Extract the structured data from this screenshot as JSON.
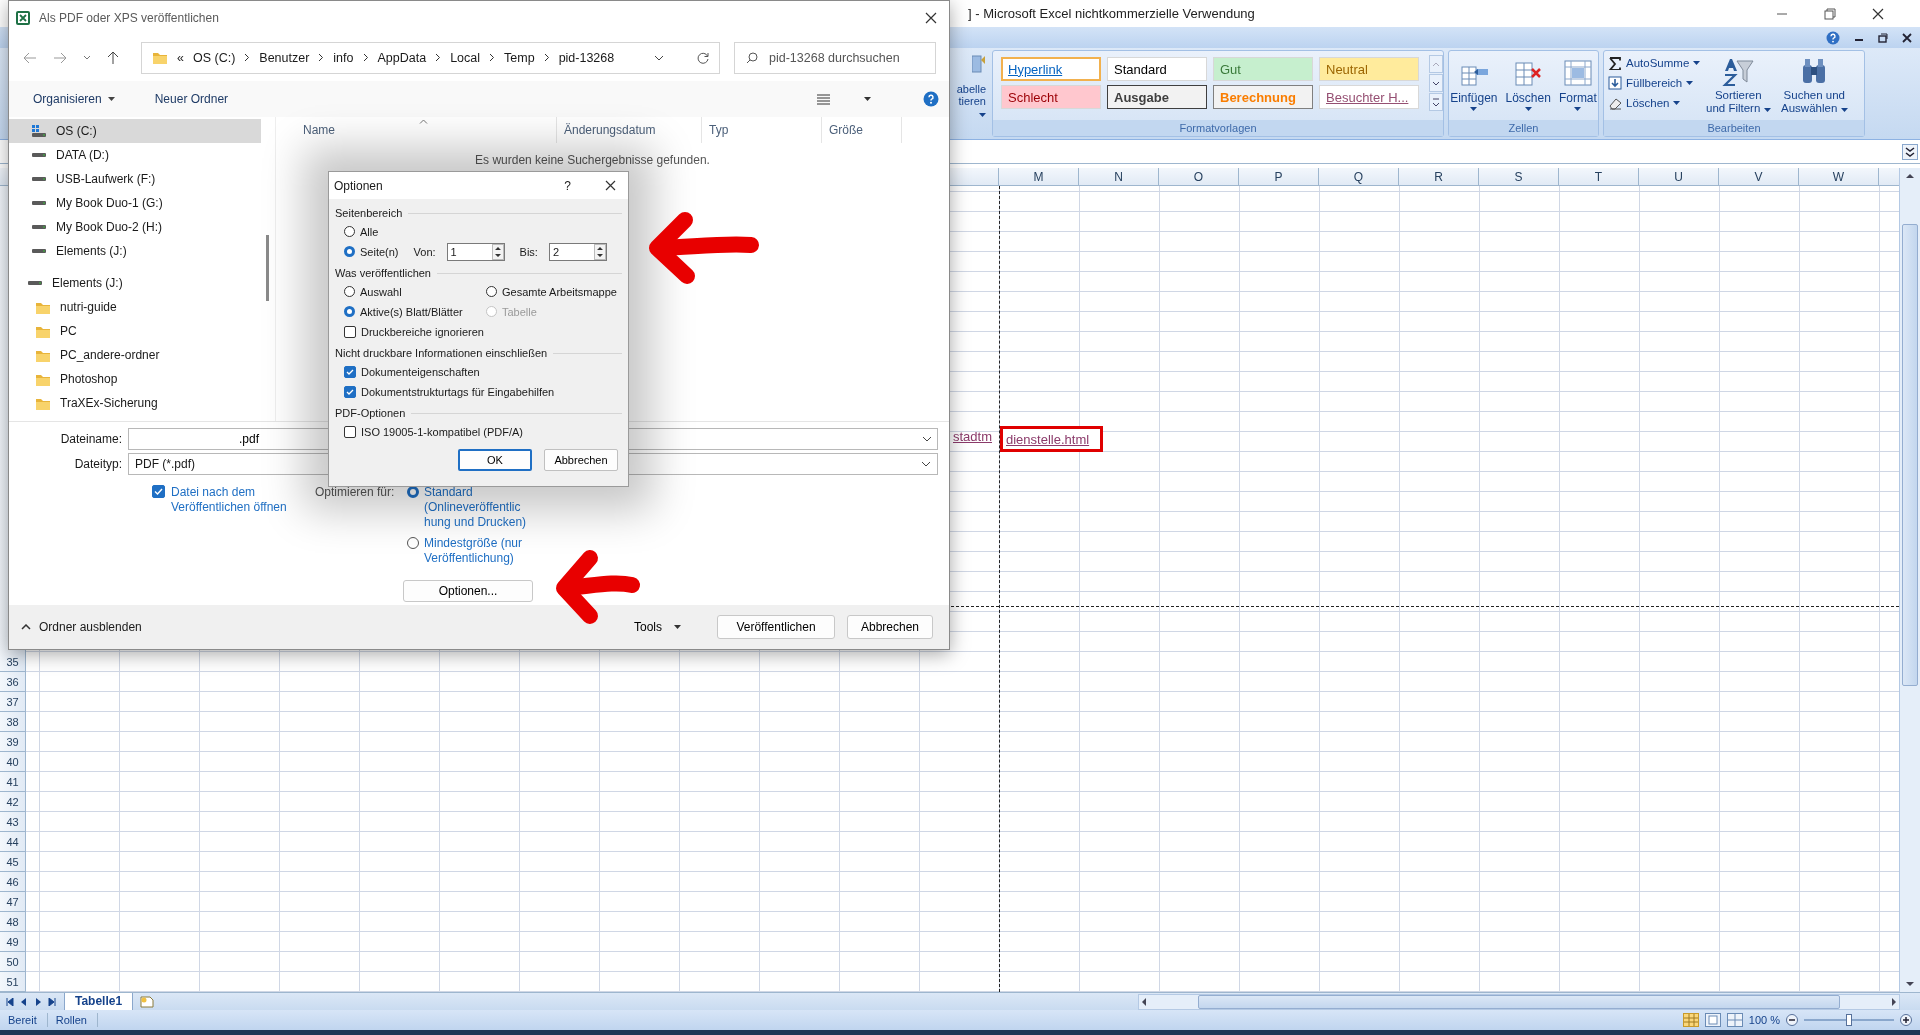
{
  "excel": {
    "title": "] - Microsoft Excel nichtkommerzielle Verwendung",
    "ribbon": {
      "format_table_cut": [
        "abelle",
        "tieren"
      ],
      "styles": {
        "label": "Formatvorlagen",
        "items": [
          {
            "label": "Hyperlink",
            "kind": "hyperlink",
            "selected": true
          },
          {
            "label": "Standard",
            "kind": "normal",
            "selected": false
          },
          {
            "label": "Gut",
            "kind": "good",
            "selected": false
          },
          {
            "label": "Neutral",
            "kind": "neutral",
            "selected": false
          },
          {
            "label": "Schlecht",
            "kind": "bad",
            "selected": false
          },
          {
            "label": "Ausgabe",
            "kind": "output",
            "selected": false
          },
          {
            "label": "Berechnung",
            "kind": "calc",
            "selected": false
          },
          {
            "label": "Besuchter H...",
            "kind": "visited",
            "selected": false
          }
        ]
      },
      "cells": {
        "label": "Zellen",
        "buttons": [
          {
            "label": "Einfügen",
            "kind": "insert"
          },
          {
            "label": "Löschen",
            "kind": "delete"
          },
          {
            "label": "Format",
            "kind": "format"
          }
        ]
      },
      "editing": {
        "label": "Bearbeiten",
        "small_buttons": [
          {
            "label": "AutoSumme",
            "kind": "sum"
          },
          {
            "label": "Füllbereich",
            "kind": "fill"
          },
          {
            "label": "Löschen",
            "kind": "clear"
          }
        ],
        "large_buttons": [
          {
            "label": "Sortieren und Filtern",
            "kind": "sort"
          },
          {
            "label": "Suchen und Auswählen",
            "kind": "find"
          }
        ]
      }
    },
    "columns": [
      "M",
      "N",
      "O",
      "P",
      "Q",
      "R",
      "S",
      "T",
      "U",
      "V",
      "W"
    ],
    "rows": [
      "35",
      "36",
      "37",
      "38",
      "39",
      "40",
      "41",
      "42",
      "43",
      "44",
      "45",
      "46",
      "47",
      "48",
      "49",
      "50",
      "51"
    ],
    "link_cell": {
      "visible_start": "stadtm",
      "highlighted_part": "dienstelle.html"
    },
    "sheet_tabs": [
      {
        "label": "Tabelle1",
        "selected": true
      }
    ],
    "status_bar": {
      "items": [
        "Bereit",
        "Rollen"
      ],
      "zoom": "100 %",
      "zoom_slider": {
        "level": 0.5
      }
    }
  },
  "save_dialog": {
    "title": "Als PDF oder XPS veröffentlichen",
    "overflow_mark": "«",
    "breadcrumb": [
      "OS (C:)",
      "Benutzer",
      "info",
      "AppData",
      "Local",
      "Temp",
      "pid-13268"
    ],
    "search": {
      "placeholder": "pid-13268 durchsuchen"
    },
    "toolbar": {
      "organize": "Organisieren",
      "new_folder": "Neuer Ordner"
    },
    "nav": {
      "pc_drives": [
        {
          "label": "OS (C:)",
          "kind": "system-drive",
          "selected": true
        },
        {
          "label": "DATA (D:)",
          "kind": "drive",
          "selected": false
        },
        {
          "label": "USB-Laufwerk (F:)",
          "kind": "drive",
          "selected": false
        },
        {
          "label": "My Book Duo-1 (G:)",
          "kind": "drive",
          "selected": false
        },
        {
          "label": "My Book Duo-2 (H:)",
          "kind": "drive",
          "selected": false
        },
        {
          "label": "Elements (J:)",
          "kind": "drive",
          "selected": false
        }
      ],
      "drive_tree": {
        "label": "Elements (J:)",
        "children": [
          {
            "label": "nutri-guide"
          },
          {
            "label": "PC"
          },
          {
            "label": "PC_andere-ordner"
          },
          {
            "label": "Photoshop"
          },
          {
            "label": "TraXEx-Sicherung"
          }
        ]
      }
    },
    "columns": [
      "Name",
      "Änderungsdatum",
      "Typ",
      "Größe"
    ],
    "empty_message": "Es wurden keine Suchergebnisse gefunden.",
    "file_name": {
      "label": "Dateiname:",
      "value": ".pdf"
    },
    "file_type": {
      "label": "Dateityp:",
      "value": "PDF (*.pdf)"
    },
    "open_after": {
      "label": "Datei nach dem Veröffentlichen öffnen",
      "checked": true
    },
    "optimize": {
      "label": "Optimieren für:",
      "options": [
        {
          "label": "Standard (Onlineveröffentlichung und Drucken)",
          "selected": true
        },
        {
          "label": "Mindestgröße (nur Veröffentlichung)",
          "selected": false
        }
      ]
    },
    "options_button": "Optionen...",
    "hide_folders": "Ordner ausblenden",
    "tools": "Tools",
    "publish": "Veröffentlichen",
    "cancel": "Abbrechen"
  },
  "options_dialog": {
    "title": "Optionen",
    "help": "?",
    "groups": [
      {
        "title": "Seitenbereich",
        "controls": [
          {
            "kind": "radio",
            "label": "Alle",
            "selected": false,
            "disabled": false
          },
          {
            "kind": "range",
            "label": "Seite(n)",
            "selected": true,
            "disabled": false,
            "from_label": "Von:",
            "from": "1",
            "to_label": "Bis:",
            "to": "2"
          }
        ]
      },
      {
        "title": "Was veröffentlichen",
        "controls": [
          {
            "kind": "radio",
            "label": "Auswahl",
            "selected": false,
            "disabled": false
          },
          {
            "kind": "radio",
            "label": "Gesamte Arbeitsmappe",
            "selected": false,
            "disabled": false
          },
          {
            "kind": "radio",
            "label": "Aktive(s) Blatt/Blätter",
            "selected": true,
            "disabled": false
          },
          {
            "kind": "radio",
            "label": "Tabelle",
            "selected": false,
            "disabled": true
          },
          {
            "kind": "checkbox",
            "label": "Druckbereiche ignorieren",
            "checked": false,
            "disabled": false
          }
        ]
      },
      {
        "title": "Nicht druckbare Informationen einschließen",
        "controls": [
          {
            "kind": "checkbox",
            "label": "Dokumenteigenschaften",
            "checked": true,
            "disabled": false
          },
          {
            "kind": "checkbox",
            "label": "Dokumentstrukturtags für Eingabehilfen",
            "checked": true,
            "disabled": false
          }
        ]
      },
      {
        "title": "PDF-Optionen",
        "controls": [
          {
            "kind": "checkbox",
            "label": "ISO 19005-1-kompatibel (PDF/A)",
            "checked": false,
            "disabled": false
          }
        ]
      }
    ],
    "ok": "OK",
    "cancel": "Abbrechen"
  }
}
